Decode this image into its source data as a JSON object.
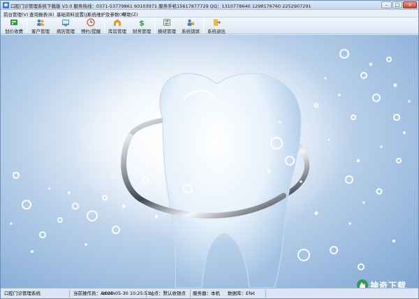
{
  "window": {
    "title": "口腔门诊管理系统下载版 V3.0 服务热线：0371-53779861 60103971 服务手机15617877729 QQ：1310778640 1298176760 2252907291"
  },
  "menu": [
    {
      "label": "前台管理(V)"
    },
    {
      "label": "查询报表(B)"
    },
    {
      "label": "基础资料设置(J)"
    },
    {
      "label": "系统维护及参数(X)"
    },
    {
      "label": "帮助(Z)"
    }
  ],
  "toolbar": [
    {
      "label": "划价收费",
      "icon": "cashier-icon"
    },
    {
      "label": "客户管理",
      "icon": "customers-icon"
    },
    {
      "label": "病历管理",
      "icon": "medical-record-icon"
    },
    {
      "label": "预约/提醒",
      "icon": "clock-icon"
    },
    {
      "label": "库房管理",
      "icon": "warehouse-icon"
    },
    {
      "label": "财务管理",
      "icon": "finance-icon"
    },
    {
      "label": "换班管理",
      "icon": "shift-icon"
    },
    {
      "label": "系统锁屏",
      "icon": "lock-icon"
    },
    {
      "label": "系统退出",
      "icon": "exit-icon"
    }
  ],
  "status": {
    "system_name": "口腔门诊管理系统",
    "operator": "当前操作员：Admin",
    "datetime": "2020-05-30 10:25:53",
    "site": "站点：默认收银点",
    "server": "服务器：本机",
    "database": "数据库：Efet"
  },
  "watermark": {
    "text": "神奇下载"
  },
  "colors": {
    "accent": "#2f6fb6",
    "background_blue": "#7ea6d3",
    "window_border": "#6d8fb8"
  }
}
